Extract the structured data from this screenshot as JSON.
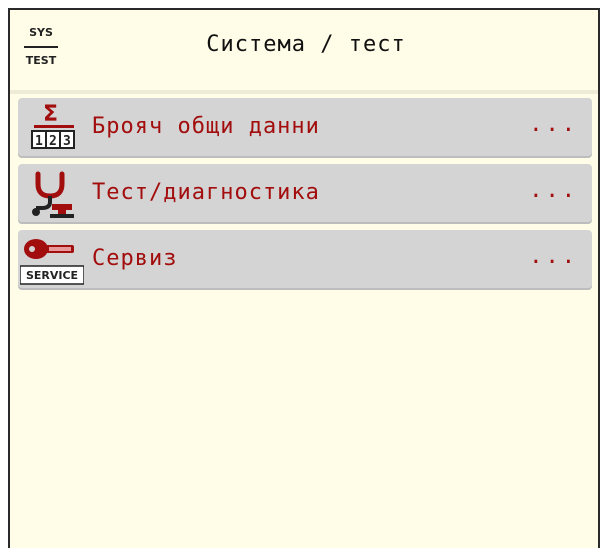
{
  "header": {
    "icon_top": "SYS",
    "icon_bottom": "TEST",
    "title": "Система / тест"
  },
  "menu": {
    "items": [
      {
        "icon": "sigma-counter-icon",
        "label": "Брояч общи данни",
        "more": "..."
      },
      {
        "icon": "stethoscope-icon",
        "label": "Тест/диагностика",
        "more": "..."
      },
      {
        "icon": "service-key-icon",
        "label": "Сервиз",
        "more": "..."
      }
    ]
  },
  "colors": {
    "background": "#fffde8",
    "item_background": "#d4d4d4",
    "accent": "#a20d0d"
  }
}
